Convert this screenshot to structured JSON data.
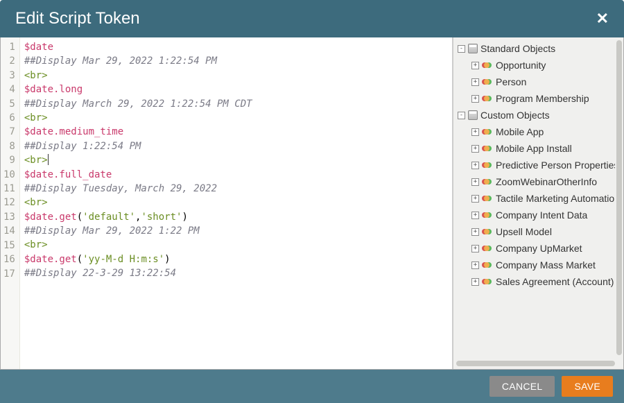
{
  "dialog": {
    "title": "Edit Script Token"
  },
  "code": {
    "lines": [
      {
        "n": 1,
        "tokens": [
          {
            "t": "$date",
            "c": "tok-var"
          }
        ]
      },
      {
        "n": 2,
        "tokens": [
          {
            "t": "##Display Mar 29, 2022 1:22:54 PM",
            "c": "tok-com"
          }
        ]
      },
      {
        "n": 3,
        "tokens": [
          {
            "t": "<br>",
            "c": "tok-tag"
          }
        ]
      },
      {
        "n": 4,
        "tokens": [
          {
            "t": "$date.long",
            "c": "tok-var"
          }
        ]
      },
      {
        "n": 5,
        "tokens": [
          {
            "t": "##Display March 29, 2022 1:22:54 PM CDT",
            "c": "tok-com"
          }
        ]
      },
      {
        "n": 6,
        "tokens": [
          {
            "t": "<br>",
            "c": "tok-tag"
          }
        ]
      },
      {
        "n": 7,
        "tokens": [
          {
            "t": "$date.medium_time",
            "c": "tok-var"
          }
        ]
      },
      {
        "n": 8,
        "tokens": [
          {
            "t": "##Display 1:22:54 PM",
            "c": "tok-com"
          }
        ]
      },
      {
        "n": 9,
        "tokens": [
          {
            "t": "<br>",
            "c": "tok-tag"
          }
        ],
        "caret": true
      },
      {
        "n": 10,
        "tokens": [
          {
            "t": "$date.full_date",
            "c": "tok-var"
          }
        ]
      },
      {
        "n": 11,
        "tokens": [
          {
            "t": "##Display Tuesday, March 29, 2022",
            "c": "tok-com"
          }
        ]
      },
      {
        "n": 12,
        "tokens": [
          {
            "t": "<br>",
            "c": "tok-tag"
          }
        ]
      },
      {
        "n": 13,
        "tokens": [
          {
            "t": "$date.get",
            "c": "tok-var"
          },
          {
            "t": "(",
            "c": ""
          },
          {
            "t": "'default'",
            "c": "tok-str"
          },
          {
            "t": ",",
            "c": ""
          },
          {
            "t": "'short'",
            "c": "tok-str"
          },
          {
            "t": ")",
            "c": ""
          }
        ]
      },
      {
        "n": 14,
        "tokens": [
          {
            "t": "##Display Mar 29, 2022 1:22 PM",
            "c": "tok-com"
          }
        ]
      },
      {
        "n": 15,
        "tokens": [
          {
            "t": "<br>",
            "c": "tok-tag"
          }
        ]
      },
      {
        "n": 16,
        "tokens": [
          {
            "t": "$date.get",
            "c": "tok-var"
          },
          {
            "t": "(",
            "c": ""
          },
          {
            "t": "'yy-M-d H:m:s'",
            "c": "tok-str"
          },
          {
            "t": ")",
            "c": ""
          }
        ]
      },
      {
        "n": 17,
        "tokens": [
          {
            "t": "##Display 22-3-29 13:22:54",
            "c": "tok-com"
          }
        ]
      }
    ]
  },
  "tree": {
    "groups": [
      {
        "label": "Standard Objects",
        "expanded": true,
        "children": [
          {
            "label": "Opportunity"
          },
          {
            "label": "Person"
          },
          {
            "label": "Program Membership"
          }
        ]
      },
      {
        "label": "Custom Objects",
        "expanded": true,
        "children": [
          {
            "label": "Mobile App"
          },
          {
            "label": "Mobile App Install"
          },
          {
            "label": "Predictive Person Properties"
          },
          {
            "label": "ZoomWebinarOtherInfo"
          },
          {
            "label": "Tactile Marketing Automation"
          },
          {
            "label": "Company Intent Data"
          },
          {
            "label": "Upsell Model"
          },
          {
            "label": "Company UpMarket"
          },
          {
            "label": "Company Mass Market"
          },
          {
            "label": "Sales Agreement (Account)"
          }
        ]
      }
    ]
  },
  "footer": {
    "cancel_label": "CANCEL",
    "save_label": "SAVE"
  }
}
